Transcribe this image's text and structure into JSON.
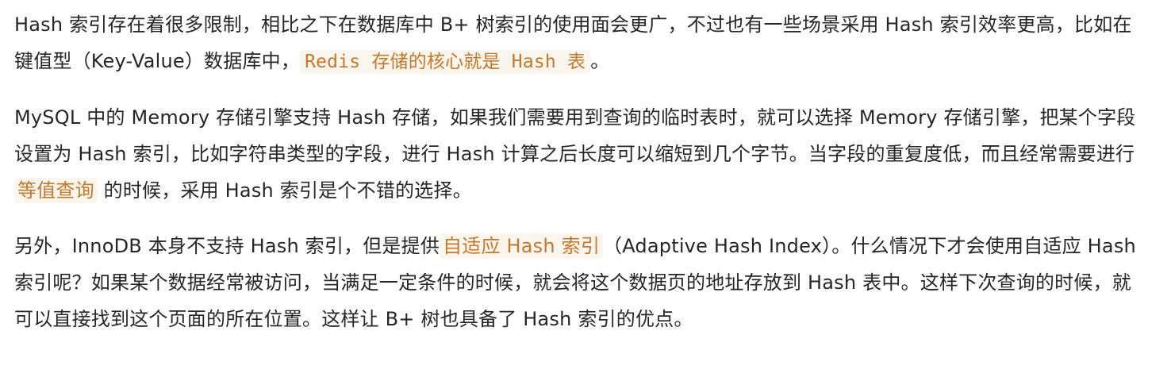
{
  "paragraphs": [
    {
      "text_1": "Hash 索引存在着很多限制，相比之下在数据库中 B+ 树索引的使用面会更广，不过也有一些场景采用 Hash 索引效率更高，比如在键值型（Key-Value）数据库中，",
      "code_1": "Redis 存储的核心就是 Hash 表",
      "text_2": "。"
    },
    {
      "text_1": "MySQL 中的 Memory 存储引擎支持 Hash 存储，如果我们需要用到查询的临时表时，就可以选择 Memory 存储引擎，把某个字段设置为 Hash 索引，比如字符串类型的字段，进行 Hash 计算之后长度可以缩短到几个字节。当字段的重复度低，而且经常需要进行",
      "highlight_1": "等值查询",
      "text_2": "的时候，采用 Hash 索引是个不错的选择。"
    },
    {
      "text_1": "另外，InnoDB 本身不支持 Hash 索引，但是提供",
      "highlight_1": "自适应 Hash 索引",
      "text_2": "（Adaptive Hash Index）。什么情况下才会使用自适应 Hash 索引呢？如果某个数据经常被访问，当满足一定条件的时候，就会将这个数据页的地址存放到 Hash 表中。这样下次查询的时候，就可以直接找到这个页面的所在位置。这样让 B+ 树也具备了 Hash 索引的优点。"
    }
  ],
  "colors": {
    "text": "#262626",
    "highlight_text": "#c7772a",
    "highlight_bg": "#faf6ee"
  }
}
